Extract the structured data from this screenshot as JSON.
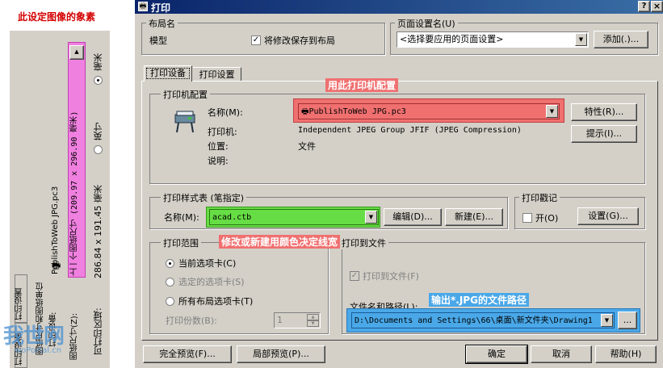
{
  "left_panel": {
    "annotation_top": "此设定图像的象素",
    "printer_name": "PublishToWeb JPG.pc3",
    "paper_size": "上一个图纸尺寸 (209.97 x 296.90 毫米)",
    "unit_mm": "毫米",
    "unit_inch": "英寸",
    "printable_area_value": "286.84 x 191.45 毫米",
    "label_paper_size_units": "图纸尺寸和图纸单位",
    "label_print_device": "打印设备:",
    "label_paper_size": "图纸尺寸(Z):",
    "label_printable_area": "可打印区域:",
    "tab_settings": "打印设置",
    "tab_device": "打印设备",
    "watermark_big": "我世网",
    "watermark_small": "woPortal.cn"
  },
  "dialog": {
    "title": "打印",
    "help_btn": "?",
    "close_btn": "×",
    "layout_group": "布局名",
    "layout_name": "模型",
    "save_changes": "将修改保存到布局",
    "page_setup_group": "页面设置名(U)",
    "page_setup_value": "<选择要应用的页面设置>",
    "add_btn": "添加(.)...",
    "tab_device": "打印设备",
    "tab_settings": "打印设置",
    "printer_config_group": "打印机配置",
    "name_label": "名称(M):",
    "name_value": "PublishToWeb JPG.pc3",
    "printer_label": "打印机:",
    "printer_value": "Independent JPEG Group JFIF (JPEG Compression)",
    "location_label": "位置:",
    "location_value": "文件",
    "desc_label": "说明:",
    "properties_btn": "特性(R)...",
    "hints_btn": "提示(I)...",
    "plot_style_group": "打印样式表 (笔指定)",
    "ps_name_label": "名称(M):",
    "ps_value": "acad.ctb",
    "edit_btn": "编辑(D)...",
    "new_btn": "新建(E)...",
    "stamp_group": "打印戳记",
    "stamp_on": "开(O)",
    "stamp_settings_btn": "设置(G)...",
    "range_group": "打印范围",
    "range_current": "当前选项卡(C)",
    "range_selected": "选定的选项卡(S)",
    "range_all": "所有布局选项卡(T)",
    "copies_label": "打印份数(B):",
    "copies_value": "1",
    "to_file_group": "打印到文件",
    "plot_to_file": "打印到文件(F)",
    "file_path_label": "文件名和路径(L):",
    "file_path_value": "D:\\Documents and Settings\\66\\桌面\\新文件夹\\Drawing1",
    "browse_btn": "...",
    "full_preview_btn": "完全预览(F)...",
    "partial_preview_btn": "局部预览(P)...",
    "ok_btn": "确定",
    "cancel_btn": "取消",
    "help_bottom_btn": "帮助(H)"
  },
  "annotations": {
    "use_printer": "用此打印机配置",
    "line_width": "修改或新建用颜色决定线宽",
    "output_path": "输出*.JPG的文件路径"
  },
  "colors": {
    "highlight_red": "#f07070",
    "highlight_green": "#66dd44",
    "highlight_blue": "#4aa8e8",
    "highlight_pink": "#f080e0",
    "dialog_bg": "#d4d0c8",
    "title_bar": "#0a246a"
  }
}
